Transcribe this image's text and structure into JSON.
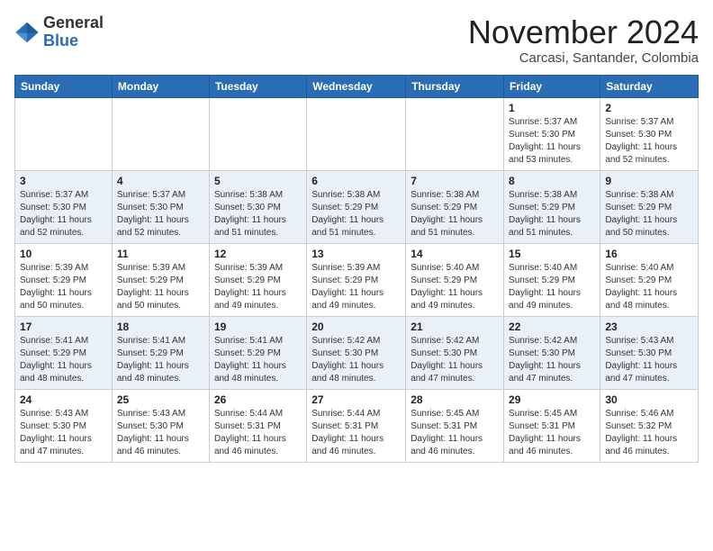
{
  "header": {
    "logo_general": "General",
    "logo_blue": "Blue",
    "month_title": "November 2024",
    "location": "Carcasi, Santander, Colombia"
  },
  "days_of_week": [
    "Sunday",
    "Monday",
    "Tuesday",
    "Wednesday",
    "Thursday",
    "Friday",
    "Saturday"
  ],
  "weeks": [
    [
      {
        "day": "",
        "info": ""
      },
      {
        "day": "",
        "info": ""
      },
      {
        "day": "",
        "info": ""
      },
      {
        "day": "",
        "info": ""
      },
      {
        "day": "",
        "info": ""
      },
      {
        "day": "1",
        "info": "Sunrise: 5:37 AM\nSunset: 5:30 PM\nDaylight: 11 hours\nand 53 minutes."
      },
      {
        "day": "2",
        "info": "Sunrise: 5:37 AM\nSunset: 5:30 PM\nDaylight: 11 hours\nand 52 minutes."
      }
    ],
    [
      {
        "day": "3",
        "info": "Sunrise: 5:37 AM\nSunset: 5:30 PM\nDaylight: 11 hours\nand 52 minutes."
      },
      {
        "day": "4",
        "info": "Sunrise: 5:37 AM\nSunset: 5:30 PM\nDaylight: 11 hours\nand 52 minutes."
      },
      {
        "day": "5",
        "info": "Sunrise: 5:38 AM\nSunset: 5:30 PM\nDaylight: 11 hours\nand 51 minutes."
      },
      {
        "day": "6",
        "info": "Sunrise: 5:38 AM\nSunset: 5:29 PM\nDaylight: 11 hours\nand 51 minutes."
      },
      {
        "day": "7",
        "info": "Sunrise: 5:38 AM\nSunset: 5:29 PM\nDaylight: 11 hours\nand 51 minutes."
      },
      {
        "day": "8",
        "info": "Sunrise: 5:38 AM\nSunset: 5:29 PM\nDaylight: 11 hours\nand 51 minutes."
      },
      {
        "day": "9",
        "info": "Sunrise: 5:38 AM\nSunset: 5:29 PM\nDaylight: 11 hours\nand 50 minutes."
      }
    ],
    [
      {
        "day": "10",
        "info": "Sunrise: 5:39 AM\nSunset: 5:29 PM\nDaylight: 11 hours\nand 50 minutes."
      },
      {
        "day": "11",
        "info": "Sunrise: 5:39 AM\nSunset: 5:29 PM\nDaylight: 11 hours\nand 50 minutes."
      },
      {
        "day": "12",
        "info": "Sunrise: 5:39 AM\nSunset: 5:29 PM\nDaylight: 11 hours\nand 49 minutes."
      },
      {
        "day": "13",
        "info": "Sunrise: 5:39 AM\nSunset: 5:29 PM\nDaylight: 11 hours\nand 49 minutes."
      },
      {
        "day": "14",
        "info": "Sunrise: 5:40 AM\nSunset: 5:29 PM\nDaylight: 11 hours\nand 49 minutes."
      },
      {
        "day": "15",
        "info": "Sunrise: 5:40 AM\nSunset: 5:29 PM\nDaylight: 11 hours\nand 49 minutes."
      },
      {
        "day": "16",
        "info": "Sunrise: 5:40 AM\nSunset: 5:29 PM\nDaylight: 11 hours\nand 48 minutes."
      }
    ],
    [
      {
        "day": "17",
        "info": "Sunrise: 5:41 AM\nSunset: 5:29 PM\nDaylight: 11 hours\nand 48 minutes."
      },
      {
        "day": "18",
        "info": "Sunrise: 5:41 AM\nSunset: 5:29 PM\nDaylight: 11 hours\nand 48 minutes."
      },
      {
        "day": "19",
        "info": "Sunrise: 5:41 AM\nSunset: 5:29 PM\nDaylight: 11 hours\nand 48 minutes."
      },
      {
        "day": "20",
        "info": "Sunrise: 5:42 AM\nSunset: 5:30 PM\nDaylight: 11 hours\nand 48 minutes."
      },
      {
        "day": "21",
        "info": "Sunrise: 5:42 AM\nSunset: 5:30 PM\nDaylight: 11 hours\nand 47 minutes."
      },
      {
        "day": "22",
        "info": "Sunrise: 5:42 AM\nSunset: 5:30 PM\nDaylight: 11 hours\nand 47 minutes."
      },
      {
        "day": "23",
        "info": "Sunrise: 5:43 AM\nSunset: 5:30 PM\nDaylight: 11 hours\nand 47 minutes."
      }
    ],
    [
      {
        "day": "24",
        "info": "Sunrise: 5:43 AM\nSunset: 5:30 PM\nDaylight: 11 hours\nand 47 minutes."
      },
      {
        "day": "25",
        "info": "Sunrise: 5:43 AM\nSunset: 5:30 PM\nDaylight: 11 hours\nand 46 minutes."
      },
      {
        "day": "26",
        "info": "Sunrise: 5:44 AM\nSunset: 5:31 PM\nDaylight: 11 hours\nand 46 minutes."
      },
      {
        "day": "27",
        "info": "Sunrise: 5:44 AM\nSunset: 5:31 PM\nDaylight: 11 hours\nand 46 minutes."
      },
      {
        "day": "28",
        "info": "Sunrise: 5:45 AM\nSunset: 5:31 PM\nDaylight: 11 hours\nand 46 minutes."
      },
      {
        "day": "29",
        "info": "Sunrise: 5:45 AM\nSunset: 5:31 PM\nDaylight: 11 hours\nand 46 minutes."
      },
      {
        "day": "30",
        "info": "Sunrise: 5:46 AM\nSunset: 5:32 PM\nDaylight: 11 hours\nand 46 minutes."
      }
    ]
  ]
}
